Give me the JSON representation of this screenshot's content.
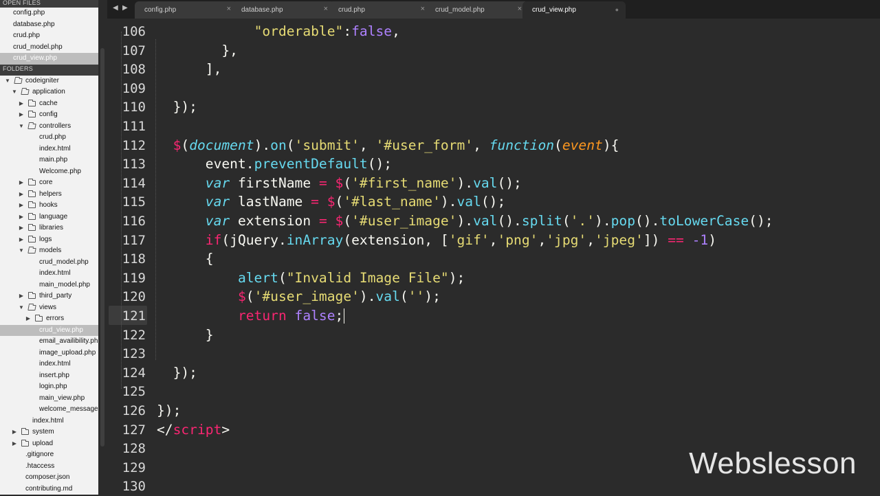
{
  "sidebar": {
    "open_files_title": "OPEN FILES",
    "open_files": [
      "config.php",
      "database.php",
      "crud.php",
      "crud_model.php",
      "crud_view.php"
    ],
    "folders_title": "FOLDERS",
    "tree": [
      {
        "label": "codeigniter",
        "depth": 0,
        "kind": "folder",
        "expanded": true
      },
      {
        "label": "application",
        "depth": 1,
        "kind": "folder",
        "expanded": true
      },
      {
        "label": "cache",
        "depth": 2,
        "kind": "folder",
        "expanded": false
      },
      {
        "label": "config",
        "depth": 2,
        "kind": "folder",
        "expanded": false
      },
      {
        "label": "controllers",
        "depth": 2,
        "kind": "folder",
        "expanded": true
      },
      {
        "label": "crud.php",
        "depth": 3,
        "kind": "file"
      },
      {
        "label": "index.html",
        "depth": 3,
        "kind": "file"
      },
      {
        "label": "main.php",
        "depth": 3,
        "kind": "file"
      },
      {
        "label": "Welcome.php",
        "depth": 3,
        "kind": "file"
      },
      {
        "label": "core",
        "depth": 2,
        "kind": "folder",
        "expanded": false
      },
      {
        "label": "helpers",
        "depth": 2,
        "kind": "folder",
        "expanded": false
      },
      {
        "label": "hooks",
        "depth": 2,
        "kind": "folder",
        "expanded": false
      },
      {
        "label": "language",
        "depth": 2,
        "kind": "folder",
        "expanded": false
      },
      {
        "label": "libraries",
        "depth": 2,
        "kind": "folder",
        "expanded": false
      },
      {
        "label": "logs",
        "depth": 2,
        "kind": "folder",
        "expanded": false
      },
      {
        "label": "models",
        "depth": 2,
        "kind": "folder",
        "expanded": true
      },
      {
        "label": "crud_model.php",
        "depth": 3,
        "kind": "file"
      },
      {
        "label": "index.html",
        "depth": 3,
        "kind": "file"
      },
      {
        "label": "main_model.php",
        "depth": 3,
        "kind": "file"
      },
      {
        "label": "third_party",
        "depth": 2,
        "kind": "folder",
        "expanded": false
      },
      {
        "label": "views",
        "depth": 2,
        "kind": "folder",
        "expanded": true
      },
      {
        "label": "errors",
        "depth": 3,
        "kind": "folder",
        "expanded": false
      },
      {
        "label": "crud_view.php",
        "depth": 3,
        "kind": "file",
        "selected": true
      },
      {
        "label": "email_availibility.php",
        "depth": 3,
        "kind": "file"
      },
      {
        "label": "image_upload.php",
        "depth": 3,
        "kind": "file"
      },
      {
        "label": "index.html",
        "depth": 3,
        "kind": "file"
      },
      {
        "label": "insert.php",
        "depth": 3,
        "kind": "file"
      },
      {
        "label": "login.php",
        "depth": 3,
        "kind": "file"
      },
      {
        "label": "main_view.php",
        "depth": 3,
        "kind": "file"
      },
      {
        "label": "welcome_message.php",
        "depth": 3,
        "kind": "file"
      },
      {
        "label": "index.html",
        "depth": 2,
        "kind": "file"
      },
      {
        "label": "system",
        "depth": 1,
        "kind": "folder",
        "expanded": false
      },
      {
        "label": "upload",
        "depth": 1,
        "kind": "folder",
        "expanded": false
      },
      {
        "label": ".gitignore",
        "depth": 1,
        "kind": "file"
      },
      {
        "label": ".htaccess",
        "depth": 1,
        "kind": "file"
      },
      {
        "label": "composer.json",
        "depth": 1,
        "kind": "file"
      },
      {
        "label": "contributing.md",
        "depth": 1,
        "kind": "file"
      }
    ]
  },
  "tabs": {
    "nav_icons": [
      "triangle-left-icon",
      "triangle-right-icon"
    ],
    "items": [
      {
        "label": "config.php",
        "close": "×",
        "active": false
      },
      {
        "label": "database.php",
        "close": "×",
        "active": false
      },
      {
        "label": "crud.php",
        "close": "×",
        "active": false
      },
      {
        "label": "crud_model.php",
        "close": "×",
        "active": false
      },
      {
        "label": "crud_view.php",
        "close": "●",
        "active": true
      }
    ]
  },
  "editor": {
    "current_line": 121,
    "lines": [
      {
        "n": "106",
        "tokens": [
          [
            "            ",
            "plain"
          ],
          [
            "\"orderable\"",
            "str"
          ],
          [
            ":",
            "plain"
          ],
          [
            "false",
            "num"
          ],
          [
            ",",
            "plain"
          ]
        ]
      },
      {
        "n": "107",
        "tokens": [
          [
            "        },",
            "plain"
          ]
        ]
      },
      {
        "n": "108",
        "tokens": [
          [
            "      ],",
            "plain"
          ]
        ]
      },
      {
        "n": "109",
        "tokens": []
      },
      {
        "n": "110",
        "tokens": [
          [
            "  });",
            "plain"
          ]
        ]
      },
      {
        "n": "111",
        "tokens": []
      },
      {
        "n": "112",
        "tokens": [
          [
            "  ",
            "plain"
          ],
          [
            "$",
            "kw"
          ],
          [
            "(",
            "plain"
          ],
          [
            "document",
            "it"
          ],
          [
            ").",
            "plain"
          ],
          [
            "on",
            "fn"
          ],
          [
            "(",
            "plain"
          ],
          [
            "'submit'",
            "str"
          ],
          [
            ", ",
            "plain"
          ],
          [
            "'#user_form'",
            "str"
          ],
          [
            ", ",
            "plain"
          ],
          [
            "function",
            "it"
          ],
          [
            "(",
            "plain"
          ],
          [
            "event",
            "param"
          ],
          [
            "){",
            "plain"
          ]
        ]
      },
      {
        "n": "113",
        "tokens": [
          [
            "      event.",
            "plain"
          ],
          [
            "preventDefault",
            "fn"
          ],
          [
            "();",
            "plain"
          ]
        ]
      },
      {
        "n": "114",
        "tokens": [
          [
            "      ",
            "plain"
          ],
          [
            "var",
            "it"
          ],
          [
            " firstName ",
            "plain"
          ],
          [
            "=",
            "kw"
          ],
          [
            " ",
            "plain"
          ],
          [
            "$",
            "kw"
          ],
          [
            "(",
            "plain"
          ],
          [
            "'#first_name'",
            "str"
          ],
          [
            ").",
            "plain"
          ],
          [
            "val",
            "fn"
          ],
          [
            "();",
            "plain"
          ]
        ]
      },
      {
        "n": "115",
        "tokens": [
          [
            "      ",
            "plain"
          ],
          [
            "var",
            "it"
          ],
          [
            " lastName ",
            "plain"
          ],
          [
            "=",
            "kw"
          ],
          [
            " ",
            "plain"
          ],
          [
            "$",
            "kw"
          ],
          [
            "(",
            "plain"
          ],
          [
            "'#last_name'",
            "str"
          ],
          [
            ").",
            "plain"
          ],
          [
            "val",
            "fn"
          ],
          [
            "();",
            "plain"
          ]
        ]
      },
      {
        "n": "116",
        "tokens": [
          [
            "      ",
            "plain"
          ],
          [
            "var",
            "it"
          ],
          [
            " extension ",
            "plain"
          ],
          [
            "=",
            "kw"
          ],
          [
            " ",
            "plain"
          ],
          [
            "$",
            "kw"
          ],
          [
            "(",
            "plain"
          ],
          [
            "'#user_image'",
            "str"
          ],
          [
            ").",
            "plain"
          ],
          [
            "val",
            "fn"
          ],
          [
            "().",
            "plain"
          ],
          [
            "split",
            "fn"
          ],
          [
            "(",
            "plain"
          ],
          [
            "'.'",
            "str"
          ],
          [
            ").",
            "plain"
          ],
          [
            "pop",
            "fn"
          ],
          [
            "().",
            "plain"
          ],
          [
            "toLowerCase",
            "fn"
          ],
          [
            "();",
            "plain"
          ]
        ]
      },
      {
        "n": "117",
        "tokens": [
          [
            "      ",
            "plain"
          ],
          [
            "if",
            "kw"
          ],
          [
            "(jQuery.",
            "plain"
          ],
          [
            "inArray",
            "fn"
          ],
          [
            "(extension, [",
            "plain"
          ],
          [
            "'gif'",
            "str"
          ],
          [
            ",",
            "plain"
          ],
          [
            "'png'",
            "str"
          ],
          [
            ",",
            "plain"
          ],
          [
            "'jpg'",
            "str"
          ],
          [
            ",",
            "plain"
          ],
          [
            "'jpeg'",
            "str"
          ],
          [
            "]) ",
            "plain"
          ],
          [
            "==",
            "kw"
          ],
          [
            " ",
            "plain"
          ],
          [
            "-1",
            "num"
          ],
          [
            ")",
            "plain"
          ]
        ]
      },
      {
        "n": "118",
        "tokens": [
          [
            "      {",
            "plain"
          ]
        ]
      },
      {
        "n": "119",
        "tokens": [
          [
            "          ",
            "plain"
          ],
          [
            "alert",
            "fn"
          ],
          [
            "(",
            "plain"
          ],
          [
            "\"Invalid Image File\"",
            "str"
          ],
          [
            ");",
            "plain"
          ]
        ]
      },
      {
        "n": "120",
        "tokens": [
          [
            "          ",
            "plain"
          ],
          [
            "$",
            "kw"
          ],
          [
            "(",
            "plain"
          ],
          [
            "'#user_image'",
            "str"
          ],
          [
            ").",
            "plain"
          ],
          [
            "val",
            "fn"
          ],
          [
            "(",
            "plain"
          ],
          [
            "''",
            "str"
          ],
          [
            ");",
            "plain"
          ]
        ]
      },
      {
        "n": "121",
        "tokens": [
          [
            "          ",
            "plain"
          ],
          [
            "return",
            "kw"
          ],
          [
            " ",
            "plain"
          ],
          [
            "false",
            "num"
          ],
          [
            ";",
            "plain"
          ]
        ]
      },
      {
        "n": "122",
        "tokens": [
          [
            "      }",
            "plain"
          ]
        ]
      },
      {
        "n": "123",
        "tokens": []
      },
      {
        "n": "124",
        "tokens": [
          [
            "  });",
            "plain"
          ]
        ]
      },
      {
        "n": "125",
        "tokens": []
      },
      {
        "n": "126",
        "tokens": [
          [
            "});",
            "plain"
          ]
        ]
      },
      {
        "n": "127",
        "tokens": [
          [
            "</",
            "plain"
          ],
          [
            "script",
            "kw"
          ],
          [
            ">",
            "plain"
          ]
        ]
      },
      {
        "n": "128",
        "tokens": []
      },
      {
        "n": "129",
        "tokens": []
      },
      {
        "n": "130",
        "tokens": []
      }
    ]
  },
  "watermark": "Webslesson",
  "colors": {
    "background": "#2b2b2b",
    "keyword": "#f92672",
    "string": "#e6db74",
    "number": "#ae81ff",
    "function": "#66d9ef",
    "parameter": "#fd971f",
    "sidebar_bg": "#f2f2f2"
  }
}
